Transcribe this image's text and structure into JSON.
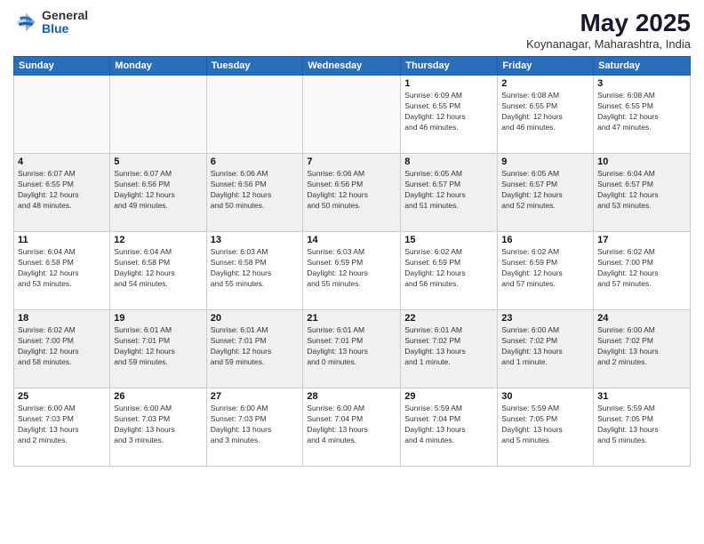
{
  "logo": {
    "general": "General",
    "blue": "Blue"
  },
  "title": "May 2025",
  "location": "Koynanagar, Maharashtra, India",
  "days_of_week": [
    "Sunday",
    "Monday",
    "Tuesday",
    "Wednesday",
    "Thursday",
    "Friday",
    "Saturday"
  ],
  "weeks": [
    [
      {
        "day": "",
        "info": ""
      },
      {
        "day": "",
        "info": ""
      },
      {
        "day": "",
        "info": ""
      },
      {
        "day": "",
        "info": ""
      },
      {
        "day": "1",
        "info": "Sunrise: 6:09 AM\nSunset: 6:55 PM\nDaylight: 12 hours\nand 46 minutes."
      },
      {
        "day": "2",
        "info": "Sunrise: 6:08 AM\nSunset: 6:55 PM\nDaylight: 12 hours\nand 46 minutes."
      },
      {
        "day": "3",
        "info": "Sunrise: 6:08 AM\nSunset: 6:55 PM\nDaylight: 12 hours\nand 47 minutes."
      }
    ],
    [
      {
        "day": "4",
        "info": "Sunrise: 6:07 AM\nSunset: 6:55 PM\nDaylight: 12 hours\nand 48 minutes."
      },
      {
        "day": "5",
        "info": "Sunrise: 6:07 AM\nSunset: 6:56 PM\nDaylight: 12 hours\nand 49 minutes."
      },
      {
        "day": "6",
        "info": "Sunrise: 6:06 AM\nSunset: 6:56 PM\nDaylight: 12 hours\nand 50 minutes."
      },
      {
        "day": "7",
        "info": "Sunrise: 6:06 AM\nSunset: 6:56 PM\nDaylight: 12 hours\nand 50 minutes."
      },
      {
        "day": "8",
        "info": "Sunrise: 6:05 AM\nSunset: 6:57 PM\nDaylight: 12 hours\nand 51 minutes."
      },
      {
        "day": "9",
        "info": "Sunrise: 6:05 AM\nSunset: 6:57 PM\nDaylight: 12 hours\nand 52 minutes."
      },
      {
        "day": "10",
        "info": "Sunrise: 6:04 AM\nSunset: 6:57 PM\nDaylight: 12 hours\nand 53 minutes."
      }
    ],
    [
      {
        "day": "11",
        "info": "Sunrise: 6:04 AM\nSunset: 6:58 PM\nDaylight: 12 hours\nand 53 minutes."
      },
      {
        "day": "12",
        "info": "Sunrise: 6:04 AM\nSunset: 6:58 PM\nDaylight: 12 hours\nand 54 minutes."
      },
      {
        "day": "13",
        "info": "Sunrise: 6:03 AM\nSunset: 6:58 PM\nDaylight: 12 hours\nand 55 minutes."
      },
      {
        "day": "14",
        "info": "Sunrise: 6:03 AM\nSunset: 6:59 PM\nDaylight: 12 hours\nand 55 minutes."
      },
      {
        "day": "15",
        "info": "Sunrise: 6:02 AM\nSunset: 6:59 PM\nDaylight: 12 hours\nand 56 minutes."
      },
      {
        "day": "16",
        "info": "Sunrise: 6:02 AM\nSunset: 6:59 PM\nDaylight: 12 hours\nand 57 minutes."
      },
      {
        "day": "17",
        "info": "Sunrise: 6:02 AM\nSunset: 7:00 PM\nDaylight: 12 hours\nand 57 minutes."
      }
    ],
    [
      {
        "day": "18",
        "info": "Sunrise: 6:02 AM\nSunset: 7:00 PM\nDaylight: 12 hours\nand 58 minutes."
      },
      {
        "day": "19",
        "info": "Sunrise: 6:01 AM\nSunset: 7:01 PM\nDaylight: 12 hours\nand 59 minutes."
      },
      {
        "day": "20",
        "info": "Sunrise: 6:01 AM\nSunset: 7:01 PM\nDaylight: 12 hours\nand 59 minutes."
      },
      {
        "day": "21",
        "info": "Sunrise: 6:01 AM\nSunset: 7:01 PM\nDaylight: 13 hours\nand 0 minutes."
      },
      {
        "day": "22",
        "info": "Sunrise: 6:01 AM\nSunset: 7:02 PM\nDaylight: 13 hours\nand 1 minute."
      },
      {
        "day": "23",
        "info": "Sunrise: 6:00 AM\nSunset: 7:02 PM\nDaylight: 13 hours\nand 1 minute."
      },
      {
        "day": "24",
        "info": "Sunrise: 6:00 AM\nSunset: 7:02 PM\nDaylight: 13 hours\nand 2 minutes."
      }
    ],
    [
      {
        "day": "25",
        "info": "Sunrise: 6:00 AM\nSunset: 7:03 PM\nDaylight: 13 hours\nand 2 minutes."
      },
      {
        "day": "26",
        "info": "Sunrise: 6:00 AM\nSunset: 7:03 PM\nDaylight: 13 hours\nand 3 minutes."
      },
      {
        "day": "27",
        "info": "Sunrise: 6:00 AM\nSunset: 7:03 PM\nDaylight: 13 hours\nand 3 minutes."
      },
      {
        "day": "28",
        "info": "Sunrise: 6:00 AM\nSunset: 7:04 PM\nDaylight: 13 hours\nand 4 minutes."
      },
      {
        "day": "29",
        "info": "Sunrise: 5:59 AM\nSunset: 7:04 PM\nDaylight: 13 hours\nand 4 minutes."
      },
      {
        "day": "30",
        "info": "Sunrise: 5:59 AM\nSunset: 7:05 PM\nDaylight: 13 hours\nand 5 minutes."
      },
      {
        "day": "31",
        "info": "Sunrise: 5:59 AM\nSunset: 7:05 PM\nDaylight: 13 hours\nand 5 minutes."
      }
    ]
  ]
}
